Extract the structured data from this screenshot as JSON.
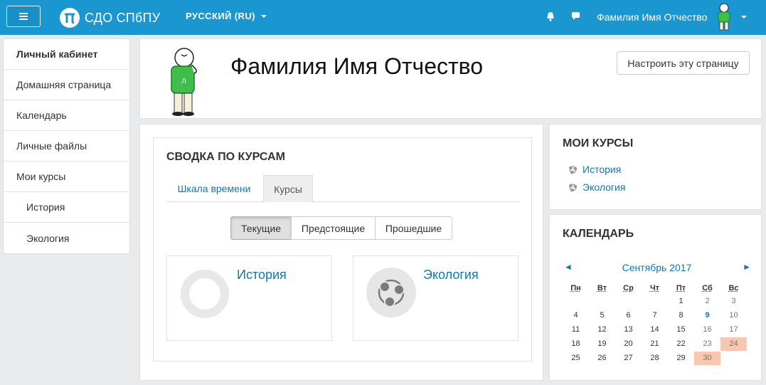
{
  "navbar": {
    "site_name": "СДО СПбПУ",
    "language": "РУССКИЙ (RU)",
    "user_name": "Фамилия Имя Отчество",
    "icons": [
      "menu-icon",
      "bell-icon",
      "chat-icon",
      "chevron-down-icon"
    ],
    "accent": "#1a97d1"
  },
  "leftnav": {
    "items": [
      {
        "label": "Личный кабинет"
      },
      {
        "label": "Домашняя страница"
      },
      {
        "label": "Календарь"
      },
      {
        "label": "Личные файлы"
      },
      {
        "label": "Мои курсы"
      },
      {
        "label": "История"
      },
      {
        "label": "Экология"
      }
    ]
  },
  "header": {
    "name": "Фамилия Имя Отчество",
    "customise_label": "Настроить эту страницу"
  },
  "overview": {
    "title": "СВОДКА ПО КУРСАМ",
    "tabs": [
      "Шкала времени",
      "Курсы"
    ],
    "filters": [
      "Текущие",
      "Предстоящие",
      "Прошедшие"
    ],
    "courses": [
      {
        "name": "История",
        "progress_label": "0%",
        "progress": 0
      },
      {
        "name": "Экология"
      }
    ]
  },
  "mycourses": {
    "title": "МОИ КУРСЫ",
    "items": [
      "История",
      "Экология"
    ]
  },
  "calendar": {
    "title": "КАЛЕНДАРЬ",
    "month": "Сентябрь 2017",
    "prev": "◄",
    "next": "►",
    "weekdays": [
      "Пн",
      "Вт",
      "Ср",
      "Чт",
      "Пт",
      "Сб",
      "Вс"
    ],
    "weeks": [
      [
        "",
        "",
        "",
        "",
        "1",
        "2",
        "3"
      ],
      [
        "4",
        "5",
        "6",
        "7",
        "8",
        "9",
        "10"
      ],
      [
        "11",
        "12",
        "13",
        "14",
        "15",
        "16",
        "17"
      ],
      [
        "18",
        "19",
        "20",
        "21",
        "22",
        "23",
        "24"
      ],
      [
        "25",
        "26",
        "27",
        "28",
        "29",
        "30",
        ""
      ]
    ],
    "event_days": [
      "9"
    ],
    "highlight_days": [
      "24",
      "30"
    ],
    "highlight_color": "#f7c7b0"
  }
}
